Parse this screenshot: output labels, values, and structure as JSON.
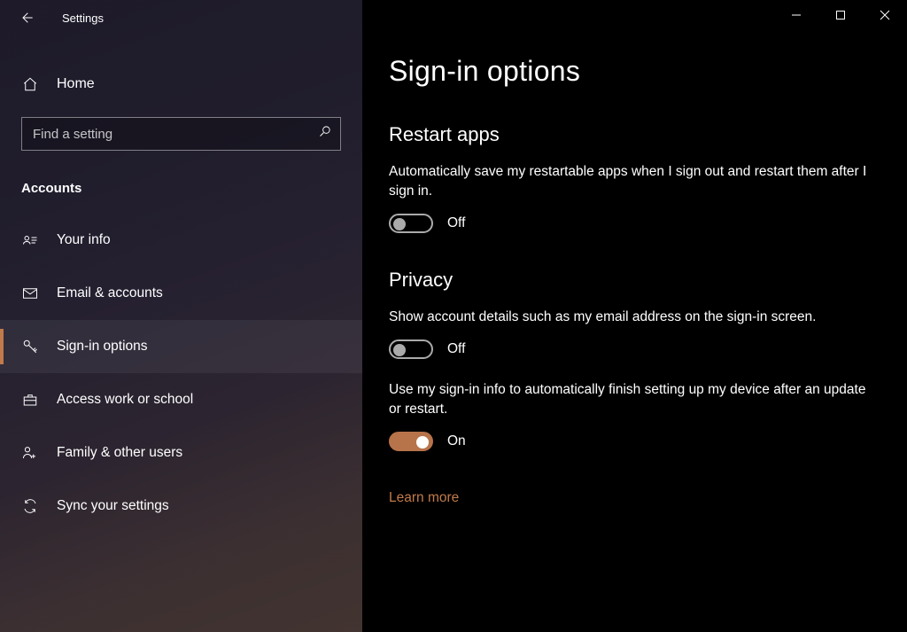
{
  "app_title": "Settings",
  "home_label": "Home",
  "search_placeholder": "Find a setting",
  "section_heading": "Accounts",
  "nav": [
    {
      "label": "Your info"
    },
    {
      "label": "Email & accounts"
    },
    {
      "label": "Sign-in options"
    },
    {
      "label": "Access work or school"
    },
    {
      "label": "Family & other users"
    },
    {
      "label": "Sync your settings"
    }
  ],
  "page_title": "Sign-in options",
  "restart_apps": {
    "heading": "Restart apps",
    "desc": "Automatically save my restartable apps when I sign out and restart them after I sign in.",
    "state_label": "Off"
  },
  "privacy": {
    "heading": "Privacy",
    "desc1": "Show account details such as my email address on the sign-in screen.",
    "state1_label": "Off",
    "desc2": "Use my sign-in info to automatically finish setting up my device after an update or restart.",
    "state2_label": "On",
    "learn_more": "Learn more"
  }
}
